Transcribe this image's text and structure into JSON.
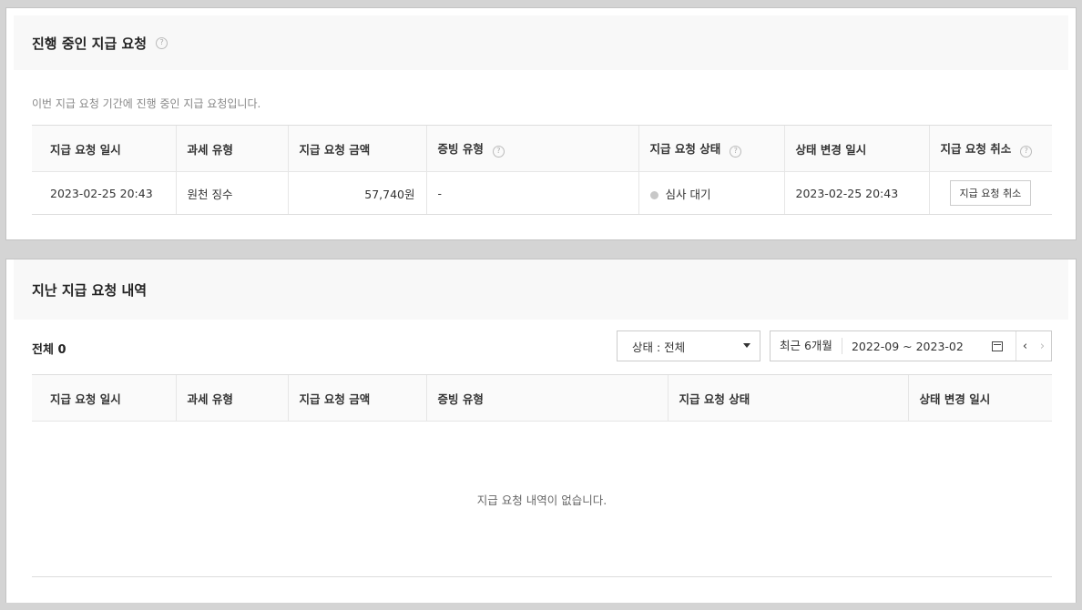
{
  "current": {
    "title": "진행 중인 지급 요청",
    "description": "이번 지급 요청 기간에 진행 중인 지급 요청입니다.",
    "columns": [
      "지급 요청 일시",
      "과세 유형",
      "지급 요청 금액",
      "증빙 유형",
      "지급 요청 상태",
      "상태 변경 일시",
      "지급 요청 취소"
    ],
    "row": {
      "date": "2023-02-25 20:43",
      "tax_type": "원천 징수",
      "amount": "57,740원",
      "proof_type": "-",
      "status": "심사 대기",
      "changed": "2023-02-25 20:43",
      "cancel_label": "지급 요청 취소"
    }
  },
  "history": {
    "title": "지난 지급 요청 내역",
    "total_label": "전체",
    "total_count": "0",
    "status_filter": "상태 : 전체",
    "recent_label": "최근 6개월",
    "range": "2022-09 ~ 2023-02",
    "columns": [
      "지급 요청 일시",
      "과세 유형",
      "지급 요청 금액",
      "증빙 유형",
      "지급 요청 상태",
      "상태 변경 일시"
    ],
    "empty": "지급 요청 내역이 없습니다."
  },
  "icons": {
    "help": "help-circle-icon",
    "calendar": "calendar-icon",
    "prev": "chevron-left-icon",
    "next": "chevron-right-icon"
  }
}
